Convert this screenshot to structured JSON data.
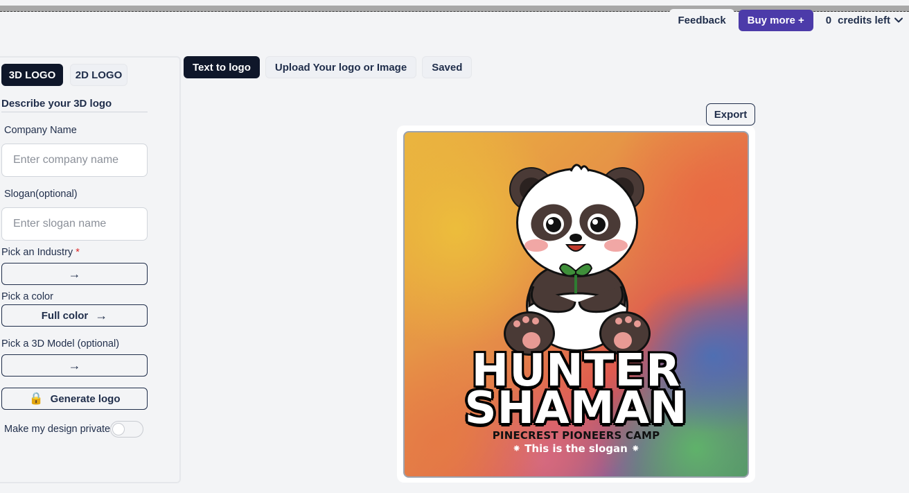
{
  "topbar": {
    "feedback_label": "Feedback",
    "buy_label": "Buy more +",
    "credits_count": "0",
    "credits_label": "credits left",
    "credits_icon": "chevron-down-icon"
  },
  "sidebar": {
    "tab_3d": "3D LOGO",
    "tab_2d": "2D LOGO",
    "describe_title": "Describe your 3D logo",
    "company_label": "Company Name",
    "company_placeholder": "Enter company name",
    "company_value": "",
    "slogan_label": "Slogan(optional)",
    "slogan_placeholder": "Enter slogan name",
    "slogan_value": "",
    "industry_label": "Pick an Industry",
    "industry_required": "*",
    "industry_arrow": "→",
    "color_label": "Pick a color",
    "color_value": "Full color",
    "color_arrow": "→",
    "model_label": "Pick a 3D Model (optional)",
    "model_arrow": "→",
    "generate_label": "Generate logo",
    "generate_icon": "🔒",
    "private_label": "Make my design private",
    "private_on": false
  },
  "main": {
    "tabs": [
      {
        "label": "Text to logo",
        "active": true
      },
      {
        "label": "Upload Your logo or Image",
        "active": false
      },
      {
        "label": "Saved",
        "active": false
      }
    ],
    "export_label": "Export",
    "logo": {
      "title_line1": "HUNTER",
      "title_line2": "SHAMAN",
      "subtitle": "PINECREST PIONEERS CAMP",
      "slogan": "⁕ This is the slogan ⁕"
    }
  },
  "colors": {
    "accent_dark": "#0f172a",
    "buy_purple": "#4c3ba9",
    "text_navy": "#1f2d4a",
    "required_red": "#dc2626"
  }
}
